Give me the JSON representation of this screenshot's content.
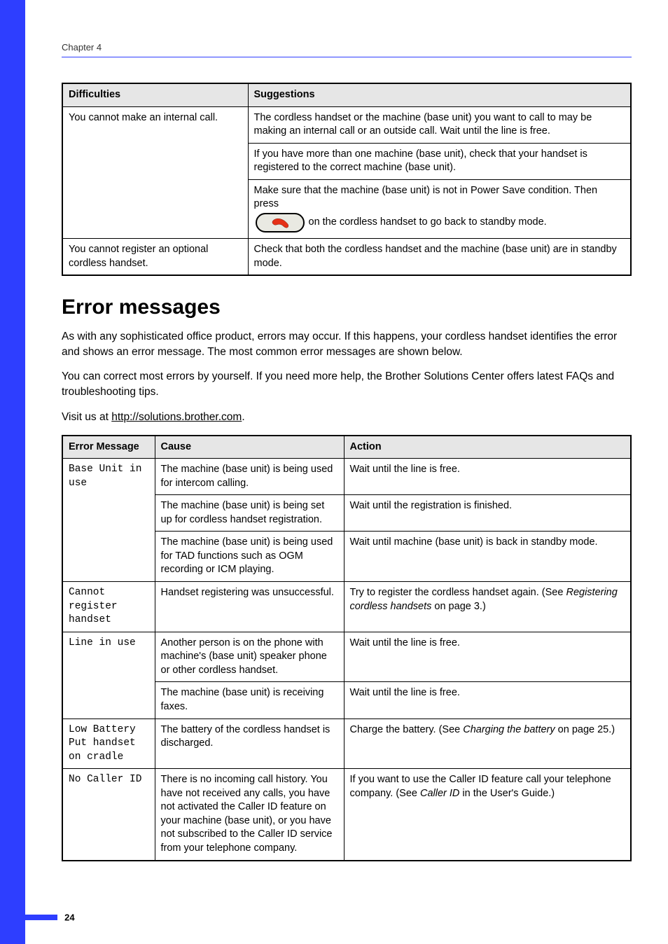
{
  "chapter": "Chapter 4",
  "table1": {
    "headers": {
      "difficulties": "Difficulties",
      "suggestions": "Suggestions"
    },
    "row1": {
      "diff": "You cannot make an internal call.",
      "sug1": "The cordless handset or the machine (base unit) you want to call to may be making an internal call or an outside call. Wait until the line is free.",
      "sug2": "If you have more than one machine (base unit), check that your handset is registered to the correct machine (base unit).",
      "sug3_pre": "Make sure that the machine (base unit) is not in Power Save condition. Then press",
      "sug3_post": "on the cordless handset to go back to standby mode."
    },
    "row2": {
      "diff": "You cannot register an optional cordless handset.",
      "sug": "Check that both the cordless handset and the machine (base unit) are in standby mode."
    }
  },
  "section": {
    "title": "Error messages",
    "p1": "As with any sophisticated office product, errors may occur. If this happens, your cordless handset identifies the error and shows an error message. The most common error messages are shown below.",
    "p2": "You can correct most errors by yourself. If you need more help, the Brother Solutions Center offers latest FAQs and troubleshooting tips.",
    "p3_pre": "Visit us at ",
    "p3_link": "http://solutions.brother.com",
    "p3_post": "."
  },
  "table2": {
    "headers": {
      "err": "Error Message",
      "cause": "Cause",
      "action": "Action"
    },
    "rows": [
      {
        "err": "Base Unit in use",
        "variants": [
          {
            "cause": "The machine (base unit) is being used for intercom calling.",
            "action": "Wait until the line is free."
          },
          {
            "cause": "The machine (base unit) is being set up for cordless handset registration.",
            "action": "Wait until the registration is finished."
          },
          {
            "cause": "The machine (base unit) is being used for TAD functions such as OGM recording or ICM playing.",
            "action": "Wait until machine (base unit) is back in standby mode."
          }
        ]
      },
      {
        "err": "Cannot register handset",
        "variants": [
          {
            "cause": "Handset registering was unsuccessful.",
            "action_pre": "Try to register the cordless handset again. (See ",
            "action_it": "Registering cordless handsets",
            "action_post": " on page 3.)"
          }
        ]
      },
      {
        "err": "Line in use",
        "variants": [
          {
            "cause": "Another person is on the phone with machine's (base unit) speaker phone or other cordless handset.",
            "action": "Wait until the line is free."
          },
          {
            "cause": "The machine (base unit) is receiving faxes.",
            "action": "Wait until the line is free."
          }
        ]
      },
      {
        "err": "Low Battery Put handset on cradle",
        "variants": [
          {
            "cause": "The battery of the cordless handset is discharged.",
            "action_pre": "Charge the battery. (See ",
            "action_it": "Charging the battery",
            "action_post": " on page 25.)"
          }
        ]
      },
      {
        "err": "No Caller ID",
        "variants": [
          {
            "cause": "There is no incoming call history. You have not received any calls, you have not activated the Caller ID feature on your machine (base unit), or you have not subscribed to the Caller ID service from your telephone company.",
            "action_pre": "If you want to use the Caller ID feature call your telephone company. (See ",
            "action_it": "Caller ID",
            "action_post": " in the User's Guide.)"
          }
        ]
      }
    ]
  },
  "page_number": "24"
}
